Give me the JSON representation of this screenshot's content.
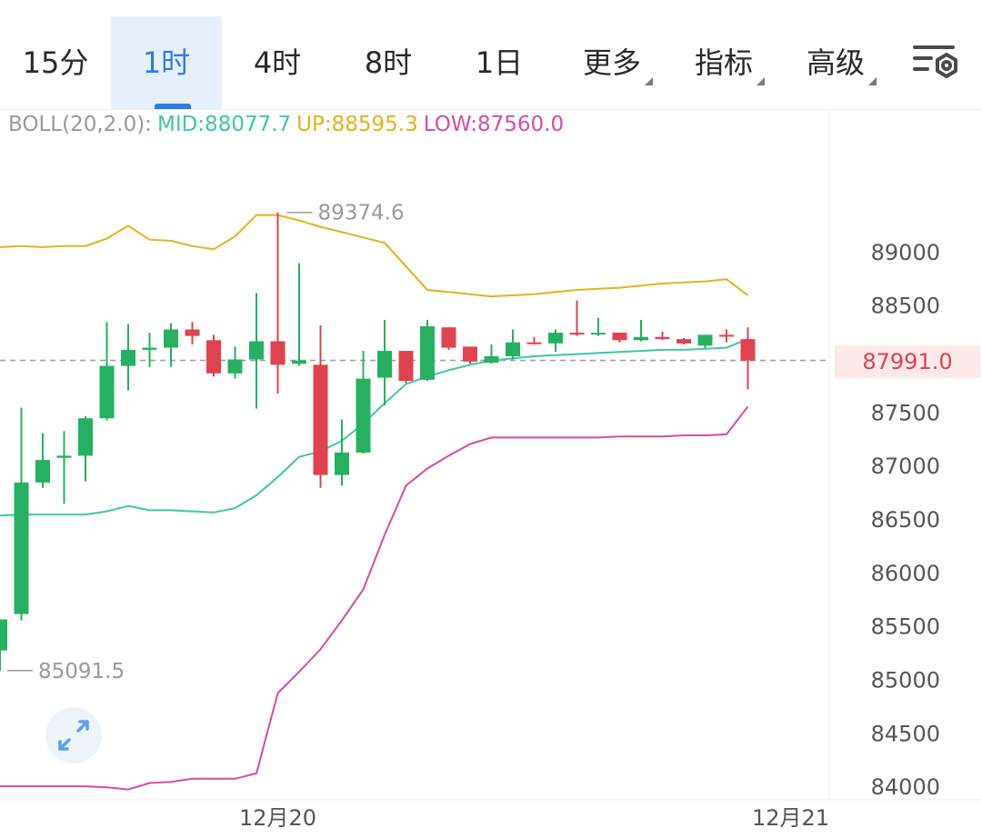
{
  "toolbar": {
    "tabs": [
      {
        "label": "15分",
        "active": false,
        "dropdown": false
      },
      {
        "label": "1时",
        "active": true,
        "dropdown": false
      },
      {
        "label": "4时",
        "active": false,
        "dropdown": false
      },
      {
        "label": "8时",
        "active": false,
        "dropdown": false
      },
      {
        "label": "1日",
        "active": false,
        "dropdown": false
      },
      {
        "label": "更多",
        "active": false,
        "dropdown": true
      },
      {
        "label": "指标",
        "active": false,
        "dropdown": true
      },
      {
        "label": "高级",
        "active": false,
        "dropdown": true
      }
    ],
    "settings_icon": "chart-settings-icon",
    "accent_color": "#2f7be6"
  },
  "indicator": {
    "title": "BOLL(20,2.0):",
    "mid": "MID:88077.7",
    "up": "UP:88595.3",
    "low": "LOW:87560.0"
  },
  "expand_icon": "expand-diagonal-icon",
  "chart_data": {
    "type": "candlestick",
    "y_range": [
      83900,
      89950
    ],
    "y_ticks": [
      84000,
      84500,
      85000,
      85500,
      86000,
      86500,
      87000,
      87500,
      88000,
      88500,
      89000
    ],
    "y_tick_labels": [
      "84000",
      "84500",
      "85000",
      "85500",
      "86000",
      "86500",
      "87000",
      "87500",
      "",
      "88500",
      "89000"
    ],
    "x_labels": [
      {
        "label": "12月20",
        "index": 13
      },
      {
        "label": "12月21",
        "index": 37
      }
    ],
    "current_price": 87991.0,
    "current_price_label": "87991.0",
    "high_marker": {
      "index": 13,
      "value": 89374.6,
      "label": "89374.6"
    },
    "low_marker": {
      "index": 0,
      "value": 85091.5,
      "label": "85091.5"
    },
    "colors": {
      "up": "#26b061",
      "down": "#e0424f",
      "boll_mid": "#3cc8a8",
      "boll_up": "#e6b21c",
      "boll_low": "#d84aa8"
    },
    "candles": [
      {
        "o": 85280,
        "h": 85560,
        "l": 85091,
        "c": 85570
      },
      {
        "o": 85620,
        "h": 87550,
        "l": 85560,
        "c": 86850
      },
      {
        "o": 86850,
        "h": 87310,
        "l": 86800,
        "c": 87060
      },
      {
        "o": 87080,
        "h": 87330,
        "l": 86650,
        "c": 87100
      },
      {
        "o": 87100,
        "h": 87470,
        "l": 86860,
        "c": 87450
      },
      {
        "o": 87450,
        "h": 88350,
        "l": 87430,
        "c": 87940
      },
      {
        "o": 87940,
        "h": 88330,
        "l": 87710,
        "c": 88090
      },
      {
        "o": 88090,
        "h": 88250,
        "l": 87930,
        "c": 88110
      },
      {
        "o": 88110,
        "h": 88340,
        "l": 87930,
        "c": 88280
      },
      {
        "o": 88280,
        "h": 88350,
        "l": 88140,
        "c": 88220
      },
      {
        "o": 88180,
        "h": 88230,
        "l": 87840,
        "c": 87870
      },
      {
        "o": 87870,
        "h": 88120,
        "l": 87820,
        "c": 88000
      },
      {
        "o": 88000,
        "h": 88620,
        "l": 87540,
        "c": 88170
      },
      {
        "o": 88170,
        "h": 89374,
        "l": 87680,
        "c": 87950
      },
      {
        "o": 87960,
        "h": 88900,
        "l": 87940,
        "c": 87990
      },
      {
        "o": 87950,
        "h": 88320,
        "l": 86800,
        "c": 86920
      },
      {
        "o": 86920,
        "h": 87440,
        "l": 86820,
        "c": 87130
      },
      {
        "o": 87130,
        "h": 88080,
        "l": 87120,
        "c": 87820
      },
      {
        "o": 87830,
        "h": 88370,
        "l": 87570,
        "c": 88080
      },
      {
        "o": 88080,
        "h": 88080,
        "l": 87780,
        "c": 87800
      },
      {
        "o": 87810,
        "h": 88370,
        "l": 87800,
        "c": 88310
      },
      {
        "o": 88300,
        "h": 88300,
        "l": 88090,
        "c": 88110
      },
      {
        "o": 88120,
        "h": 88120,
        "l": 87960,
        "c": 87980
      },
      {
        "o": 87970,
        "h": 88140,
        "l": 87960,
        "c": 88030
      },
      {
        "o": 88030,
        "h": 88280,
        "l": 88000,
        "c": 88160
      },
      {
        "o": 88160,
        "h": 88210,
        "l": 88140,
        "c": 88150
      },
      {
        "o": 88150,
        "h": 88280,
        "l": 88070,
        "c": 88250
      },
      {
        "o": 88250,
        "h": 88550,
        "l": 88220,
        "c": 88240
      },
      {
        "o": 88240,
        "h": 88390,
        "l": 88220,
        "c": 88250
      },
      {
        "o": 88250,
        "h": 88250,
        "l": 88160,
        "c": 88180
      },
      {
        "o": 88180,
        "h": 88370,
        "l": 88170,
        "c": 88210
      },
      {
        "o": 88210,
        "h": 88260,
        "l": 88180,
        "c": 88190
      },
      {
        "o": 88190,
        "h": 88200,
        "l": 88140,
        "c": 88150
      },
      {
        "o": 88130,
        "h": 88230,
        "l": 88100,
        "c": 88230
      },
      {
        "o": 88230,
        "h": 88280,
        "l": 88160,
        "c": 88220
      },
      {
        "o": 88190,
        "h": 88300,
        "l": 87720,
        "c": 87990
      }
    ],
    "boll_up": [
      89050,
      89060,
      89050,
      89060,
      89060,
      89130,
      89250,
      89120,
      89110,
      89060,
      89030,
      89150,
      89350,
      89350,
      89300,
      89240,
      89190,
      89140,
      89090,
      88870,
      88650,
      88630,
      88610,
      88590,
      88600,
      88610,
      88630,
      88650,
      88660,
      88670,
      88690,
      88710,
      88720,
      88730,
      88750,
      88600
    ],
    "boll_mid": [
      86540,
      86550,
      86550,
      86550,
      86550,
      86580,
      86630,
      86590,
      86590,
      86580,
      86570,
      86610,
      86730,
      86900,
      87090,
      87140,
      87240,
      87400,
      87590,
      87770,
      87840,
      87900,
      87950,
      87990,
      88010,
      88030,
      88040,
      88050,
      88060,
      88070,
      88080,
      88090,
      88090,
      88100,
      88110,
      88190
    ],
    "boll_low": [
      84010,
      84010,
      84010,
      84010,
      84010,
      84000,
      83980,
      84040,
      84050,
      84080,
      84080,
      84080,
      84130,
      84880,
      85080,
      85290,
      85560,
      85850,
      86360,
      86820,
      86980,
      87100,
      87210,
      87270,
      87270,
      87270,
      87270,
      87270,
      87270,
      87280,
      87280,
      87280,
      87290,
      87290,
      87300,
      87560
    ]
  }
}
